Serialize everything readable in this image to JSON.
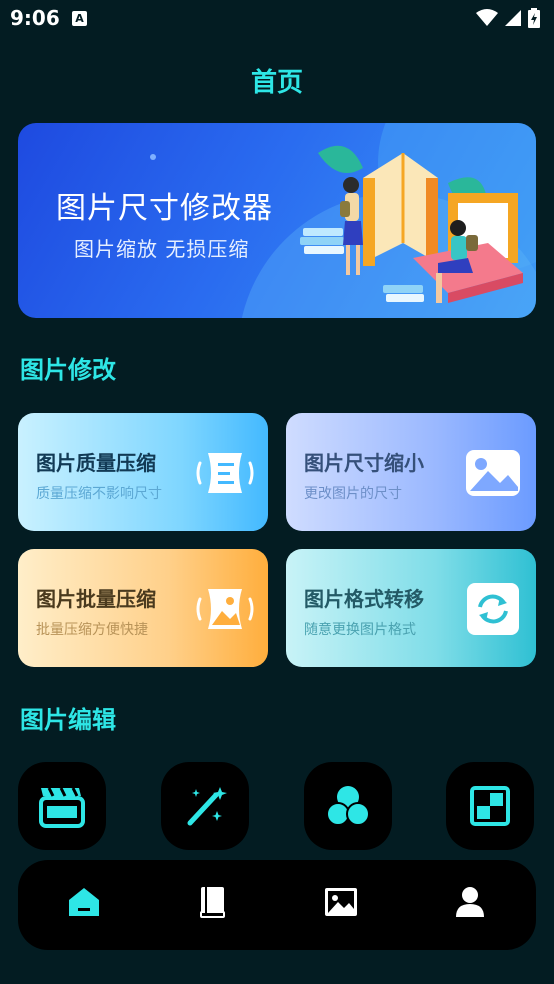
{
  "status_bar": {
    "time": "9:06",
    "indicator": "A"
  },
  "header": {
    "title": "首页"
  },
  "banner": {
    "title": "图片尺寸修改器",
    "subtitle": "图片缩放 无损压缩"
  },
  "sections": {
    "modify": {
      "title": "图片修改"
    },
    "edit": {
      "title": "图片编辑"
    }
  },
  "cards": [
    {
      "title": "图片质量压缩",
      "subtitle": "质量压缩不影响尺寸",
      "icon": "compress-icon"
    },
    {
      "title": "图片尺寸缩小",
      "subtitle": "更改图片的尺寸",
      "icon": "image-icon"
    },
    {
      "title": "图片批量压缩",
      "subtitle": "批量压缩方便快捷",
      "icon": "batch-compress-icon"
    },
    {
      "title": "图片格式转移",
      "subtitle": "随意更换图片格式",
      "icon": "convert-icon"
    }
  ],
  "tools": [
    {
      "icon": "clapperboard-icon"
    },
    {
      "icon": "magic-wand-icon"
    },
    {
      "icon": "color-filter-icon"
    },
    {
      "icon": "mosaic-icon"
    }
  ],
  "tabs": [
    {
      "icon": "home-icon",
      "active": true
    },
    {
      "icon": "book-icon",
      "active": false
    },
    {
      "icon": "gallery-icon",
      "active": false
    },
    {
      "icon": "user-icon",
      "active": false
    }
  ],
  "colors": {
    "accent": "#2ee6e6",
    "background": "#031c22",
    "banner": "#2a6cf0"
  }
}
